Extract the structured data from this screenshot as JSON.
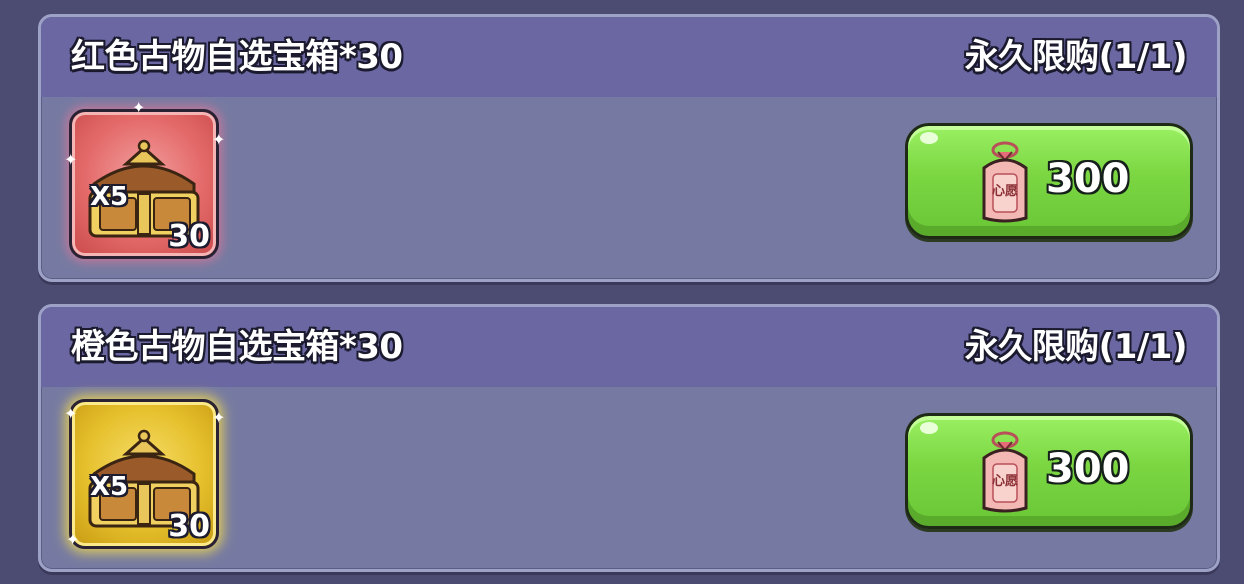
{
  "items": [
    {
      "title": "红色古物自选宝箱*30",
      "limit": "永久限购(1/1)",
      "icon": {
        "rarity": "red",
        "badge": "X5",
        "quantity": "30"
      },
      "price": "300",
      "currency_label": "心愿"
    },
    {
      "title": "橙色古物自选宝箱*30",
      "limit": "永久限购(1/1)",
      "icon": {
        "rarity": "gold",
        "badge": "X5",
        "quantity": "30"
      },
      "price": "300",
      "currency_label": "心愿"
    }
  ],
  "colors": {
    "background": "#4c4b72",
    "card": "#767aa2",
    "header": "#6a67a2",
    "buy_button": "#7bd642",
    "red_rarity": "#e46a6a",
    "gold_rarity": "#e6c02c"
  },
  "icons": [
    "treasure-chest-icon",
    "wish-token-icon",
    "sparkle-icon"
  ]
}
